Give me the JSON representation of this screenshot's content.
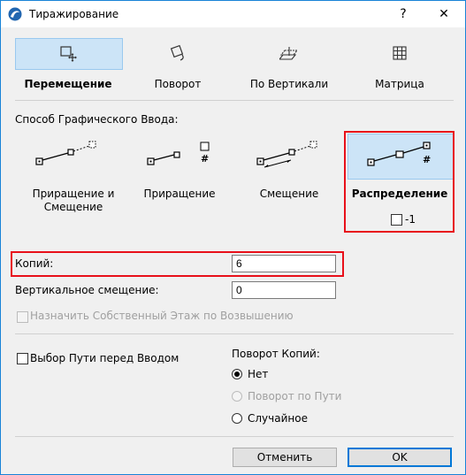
{
  "window": {
    "title": "Тиражирование",
    "help_label": "?",
    "close_label": "✕"
  },
  "modes": [
    {
      "label": "Перемещение",
      "icon": "move-icon",
      "selected": true
    },
    {
      "label": "Поворот",
      "icon": "rotate-icon",
      "selected": false
    },
    {
      "label": "По Вертикали",
      "icon": "elevate-icon",
      "selected": false
    },
    {
      "label": "Матрица",
      "icon": "matrix-icon",
      "selected": false
    }
  ],
  "input_method": {
    "heading": "Способ Графического Ввода:",
    "options": [
      {
        "label": "Приращение и Смещение",
        "selected": false
      },
      {
        "label": "Приращение",
        "selected": false,
        "hash": "#"
      },
      {
        "label": "Смещение",
        "selected": false
      },
      {
        "label": "Распределение",
        "selected": true,
        "hash": "#"
      }
    ],
    "minus_one_label": "-1",
    "minus_one_checked": false
  },
  "fields": {
    "copies_label": "Копий:",
    "copies_value": "6",
    "vertical_offset_label": "Вертикальное смещение:",
    "vertical_offset_value": "0",
    "assign_story_label": "Назначить Собственный Этаж по Возвышению",
    "assign_story_checked": false,
    "assign_story_disabled": true
  },
  "path": {
    "label": "Выбор Пути перед Вводом",
    "checked": false
  },
  "rotation": {
    "heading": "Поворот Копий:",
    "options": [
      {
        "label": "Нет",
        "selected": true,
        "disabled": false
      },
      {
        "label": "Поворот по Пути",
        "selected": false,
        "disabled": true
      },
      {
        "label": "Случайное",
        "selected": false,
        "disabled": false
      }
    ]
  },
  "buttons": {
    "cancel": "Отменить",
    "ok": "OK"
  },
  "colors": {
    "accent": "#0078d7",
    "selection": "#cce4f7",
    "highlight": "#e8101a"
  }
}
